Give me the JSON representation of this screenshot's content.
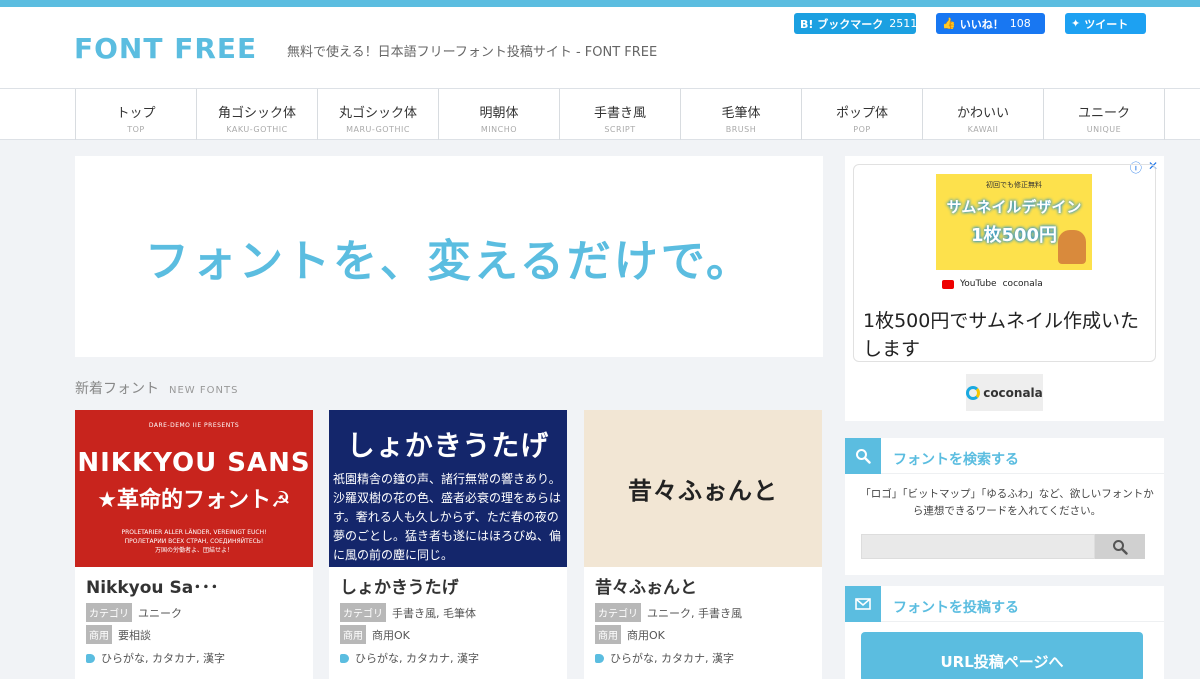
{
  "header": {
    "logo": "FONT FREE",
    "tagline": "無料で使える！日本語フリーフォント投稿サイト - FONT FREE"
  },
  "social": {
    "hatena_label": "B! ブックマーク",
    "hatena_count": "2511",
    "fb_label": "いいね！",
    "fb_count": "108",
    "tw_label": "ツイート"
  },
  "nav": [
    {
      "jp": "トップ",
      "en": "TOP"
    },
    {
      "jp": "角ゴシック体",
      "en": "KAKU-GOTHIC"
    },
    {
      "jp": "丸ゴシック体",
      "en": "MARU-GOTHIC"
    },
    {
      "jp": "明朝体",
      "en": "MINCHO"
    },
    {
      "jp": "手書き風",
      "en": "SCRIPT"
    },
    {
      "jp": "毛筆体",
      "en": "BRUSH"
    },
    {
      "jp": "ポップ体",
      "en": "POP"
    },
    {
      "jp": "かわいい",
      "en": "KAWAII"
    },
    {
      "jp": "ユニーク",
      "en": "UNIQUE"
    }
  ],
  "banner": "フォントを、変えるだけで。",
  "new_fonts": {
    "title": "新着フォント",
    "title_en": "NEW FONTS"
  },
  "cards": [
    {
      "name": "Nikkyou Sa･･･",
      "category_tag": "カテゴリ",
      "category": "ユニーク",
      "commercial_tag": "商用",
      "commercial": "要相談",
      "chars": "ひらがな, カタカナ, 漢字",
      "thumb": {
        "line1": "DARE-DEMO IIE PRESENTS",
        "line2": "NIKKYOU SANS",
        "line3": "★革命的フォント☭",
        "line4": "PROLETARIER ALLER LÄNDER, VEREINIGT EUCH!",
        "line5": "ПРОЛЕТАРИИ ВСЕХ СТРАН, СОЕДИНЯЙТЕСЬ!",
        "line6": "万国の労働者よ、団結せよ！"
      }
    },
    {
      "name": "しょかきうたげ",
      "category_tag": "カテゴリ",
      "category": "手書き風, 毛筆体",
      "commercial_tag": "商用",
      "commercial": "商用OK",
      "chars": "ひらがな, カタカナ, 漢字",
      "thumb": {
        "line1": "しょかきうたげ",
        "line2": "祇園精舎の鐘の声、諸行無常の響きあり。沙羅双樹の花の色、盛者必衰の理をあらはす。奢れる人も久しからず、ただ春の夜の夢のごとし。猛き者も遂にはほろびぬ、偏に風の前の塵に同じ。"
      }
    },
    {
      "name": "昔々ふぉんと",
      "category_tag": "カテゴリ",
      "category": "ユニーク, 手書き風",
      "commercial_tag": "商用",
      "commercial": "商用OK",
      "chars": "ひらがな, カタカナ, 漢字",
      "thumb": {
        "line1": "昔々ふぉんと"
      }
    }
  ],
  "ad": {
    "img_top": "初回でも修正無料",
    "img_h1": "サムネイルデザイン",
    "img_h2": "1枚500円",
    "img_youtube": "YouTube",
    "img_brand": "coconala",
    "text": "1枚500円でサムネイル作成いたします",
    "logo": "coconala"
  },
  "search_widget": {
    "title": "フォントを検索する",
    "desc": "「ロゴ」「ビットマップ」「ゆるふわ」など、欲しいフォントから連想できるワードを入れてください。"
  },
  "post_widget": {
    "title": "フォントを投稿する",
    "button": "URL投稿ページへ"
  },
  "colors": {
    "accent": "#5bbde0",
    "hatena": "#1ba0e1",
    "facebook": "#1877f2",
    "twitter": "#1da1f2"
  }
}
